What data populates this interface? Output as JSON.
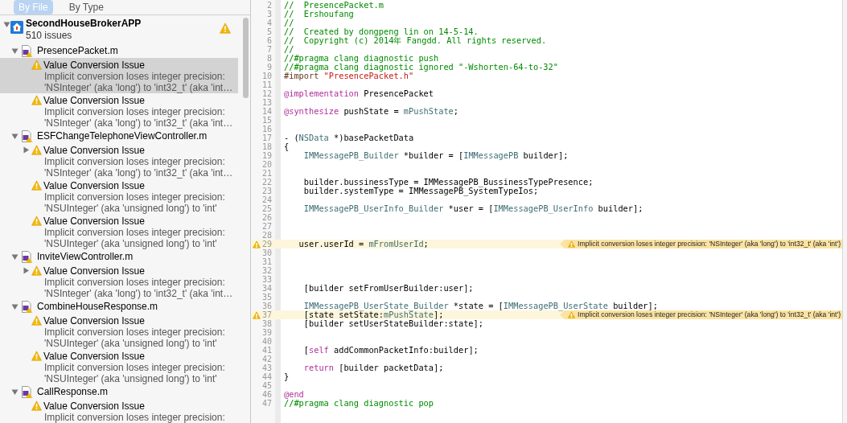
{
  "navigator": {
    "tabs": [
      {
        "label": "By File",
        "selected": true
      },
      {
        "label": "By Type",
        "selected": false
      }
    ],
    "project": {
      "name": "SecondHouseBrokerAPP",
      "count": "510 issues",
      "warning": true,
      "expanded": true
    },
    "files": [
      {
        "name": "PresencePacket.m",
        "expanded": true,
        "issues": [
          {
            "title": "Value Conversion Issue",
            "lines": [
              "Implicit conversion loses integer precision:",
              "'NSInteger' (aka 'long') to 'int32_t' (aka 'int…"
            ],
            "selected": true,
            "collapsed": false
          },
          {
            "title": "Value Conversion Issue",
            "lines": [
              "Implicit conversion loses integer precision:",
              "'NSInteger' (aka 'long') to 'int32_t' (aka 'int…"
            ],
            "selected": false,
            "collapsed": false
          }
        ]
      },
      {
        "name": "ESFChangeTelephoneViewController.m",
        "expanded": true,
        "issues": [
          {
            "title": "Value Conversion Issue",
            "lines": [
              "Implicit conversion loses integer precision:",
              "'NSInteger' (aka 'long') to 'int32_t' (aka 'int…"
            ],
            "selected": false,
            "collapsed": true
          },
          {
            "title": "Value Conversion Issue",
            "lines": [
              "Implicit conversion loses integer precision:",
              "'NSUInteger' (aka 'unsigned long') to 'int'"
            ],
            "selected": false,
            "collapsed": false
          },
          {
            "title": "Value Conversion Issue",
            "lines": [
              "Implicit conversion loses integer precision:",
              "'NSUInteger' (aka 'unsigned long') to 'int'"
            ],
            "selected": false,
            "collapsed": false
          }
        ]
      },
      {
        "name": "InviteViewController.m",
        "expanded": true,
        "issues": [
          {
            "title": "Value Conversion Issue",
            "lines": [
              "Implicit conversion loses integer precision:",
              "'NSInteger' (aka 'long') to 'int32_t' (aka 'int…"
            ],
            "selected": false,
            "collapsed": true
          }
        ]
      },
      {
        "name": "CombineHouseResponse.m",
        "expanded": true,
        "issues": [
          {
            "title": "Value Conversion Issue",
            "lines": [
              "Implicit conversion loses integer precision:",
              "'NSUInteger' (aka 'unsigned long') to 'int'"
            ],
            "selected": false,
            "collapsed": false
          },
          {
            "title": "Value Conversion Issue",
            "lines": [
              "Implicit conversion loses integer precision:",
              "'NSUInteger' (aka 'unsigned long') to 'int'"
            ],
            "selected": false,
            "collapsed": false
          }
        ]
      },
      {
        "name": "CallResponse.m",
        "expanded": true,
        "issues": [
          {
            "title": "Value Conversion Issue",
            "lines": [
              "Implicit conversion loses integer precision:"
            ],
            "selected": false,
            "collapsed": false
          }
        ]
      }
    ]
  },
  "editor": {
    "lines": [
      {
        "n": "2",
        "tokens": [
          {
            "kind": "comment",
            "t": "//  PresencePacket.m"
          }
        ]
      },
      {
        "n": "3",
        "tokens": [
          {
            "kind": "comment",
            "t": "//  Ershoufang"
          }
        ]
      },
      {
        "n": "4",
        "tokens": [
          {
            "kind": "comment",
            "t": "//"
          }
        ]
      },
      {
        "n": "5",
        "tokens": [
          {
            "kind": "comment",
            "t": "//  Created by dongpeng lin on 14-5-14."
          }
        ]
      },
      {
        "n": "6",
        "tokens": [
          {
            "kind": "comment",
            "t": "//  Copyright (c) 2014年 Fangdd. All rights reserved."
          }
        ]
      },
      {
        "n": "7",
        "tokens": [
          {
            "kind": "comment",
            "t": "//"
          }
        ]
      },
      {
        "n": "8",
        "tokens": [
          {
            "kind": "comment",
            "t": "//#pragma clang diagnostic push"
          }
        ]
      },
      {
        "n": "9",
        "tokens": [
          {
            "kind": "comment",
            "t": "//#pragma clang diagnostic ignored \"-Wshorten-64-to-32\""
          }
        ]
      },
      {
        "n": "10",
        "tokens": [
          {
            "kind": "preproc",
            "t": "#import "
          },
          {
            "kind": "string",
            "t": "\"PresencePacket.h\""
          }
        ]
      },
      {
        "n": "11"
      },
      {
        "n": "12",
        "tokens": [
          {
            "kind": "keyword",
            "t": "@implementation"
          },
          {
            "kind": "plain",
            "t": " PresencePacket"
          }
        ]
      },
      {
        "n": "13"
      },
      {
        "n": "14",
        "tokens": [
          {
            "kind": "keyword",
            "t": "@synthesize"
          },
          {
            "kind": "plain",
            "t": " pushState = "
          },
          {
            "kind": "type",
            "t": "mPushState"
          },
          {
            "kind": "plain",
            "t": ";"
          }
        ]
      },
      {
        "n": "15"
      },
      {
        "n": "16"
      },
      {
        "n": "17",
        "tokens": [
          {
            "kind": "plain",
            "t": "- ("
          },
          {
            "kind": "type",
            "t": "NSData"
          },
          {
            "kind": "plain",
            "t": " *)basePacketData"
          }
        ]
      },
      {
        "n": "18",
        "tokens": [
          {
            "kind": "plain",
            "t": "{"
          }
        ]
      },
      {
        "n": "19",
        "tokens": [
          {
            "kind": "type",
            "t": "    IMMessagePB_Builder"
          },
          {
            "kind": "plain",
            "t": " *builder = ["
          },
          {
            "kind": "type",
            "t": "IMMessagePB"
          },
          {
            "kind": "plain",
            "t": " builder];"
          }
        ]
      },
      {
        "n": "20"
      },
      {
        "n": "21"
      },
      {
        "n": "22",
        "tokens": [
          {
            "kind": "plain",
            "t": "    builder.bussinessType = IMMessagePB_BussinessTypePresence;"
          }
        ]
      },
      {
        "n": "23",
        "tokens": [
          {
            "kind": "plain",
            "t": "    builder.systemType = IMMessagePB_SystemTypeIos;"
          }
        ]
      },
      {
        "n": "24"
      },
      {
        "n": "25",
        "tokens": [
          {
            "kind": "type",
            "t": "    IMMessagePB_UserInfo_Builder"
          },
          {
            "kind": "plain",
            "t": " *user = ["
          },
          {
            "kind": "type",
            "t": "IMMessagePB_UserInfo"
          },
          {
            "kind": "plain",
            "t": " builder];"
          }
        ]
      },
      {
        "n": "26"
      },
      {
        "n": "27"
      },
      {
        "n": "28"
      },
      {
        "n": "29",
        "tokens": [
          {
            "kind": "plain",
            "t": "   user.userId = "
          },
          {
            "kind": "type",
            "t": "mFromUserId"
          },
          {
            "kind": "plain",
            "t": ";"
          }
        ],
        "warning": "Implicit conversion loses integer precision: 'NSInteger' (aka 'long') to 'int32_t' (aka 'int')"
      },
      {
        "n": "30"
      },
      {
        "n": "31"
      },
      {
        "n": "32"
      },
      {
        "n": "33"
      },
      {
        "n": "34",
        "tokens": [
          {
            "kind": "plain",
            "t": "    [builder setFromUserBuilder:user];"
          }
        ]
      },
      {
        "n": "35"
      },
      {
        "n": "36",
        "tokens": [
          {
            "kind": "type",
            "t": "    IMMessagePB_UserState_Builder"
          },
          {
            "kind": "plain",
            "t": " *state = ["
          },
          {
            "kind": "type",
            "t": "IMMessagePB_UserState"
          },
          {
            "kind": "plain",
            "t": " builder];"
          }
        ]
      },
      {
        "n": "37",
        "tokens": [
          {
            "kind": "plain",
            "t": "    [state setState:"
          },
          {
            "kind": "type",
            "t": "mPushState"
          },
          {
            "kind": "plain",
            "t": "];"
          }
        ],
        "warning": "Implicit conversion loses integer precision: 'NSInteger' (aka 'long') to 'int32_t' (aka 'int')"
      },
      {
        "n": "38",
        "tokens": [
          {
            "kind": "plain",
            "t": "    [builder setUserStateBuilder:state];"
          }
        ]
      },
      {
        "n": "39"
      },
      {
        "n": "40"
      },
      {
        "n": "41",
        "tokens": [
          {
            "kind": "plain",
            "t": "    ["
          },
          {
            "kind": "keyword",
            "t": "self"
          },
          {
            "kind": "plain",
            "t": " addCommonPacketInfo:builder];"
          }
        ]
      },
      {
        "n": "42"
      },
      {
        "n": "43",
        "tokens": [
          {
            "kind": "keyword",
            "t": "    return"
          },
          {
            "kind": "plain",
            "t": " [builder packetData];"
          }
        ]
      },
      {
        "n": "44",
        "tokens": [
          {
            "kind": "plain",
            "t": "}"
          }
        ]
      },
      {
        "n": "45"
      },
      {
        "n": "46",
        "tokens": [
          {
            "kind": "keyword",
            "t": "@end"
          }
        ]
      },
      {
        "n": "47",
        "tokens": [
          {
            "kind": "comment",
            "t": "//#pragma clang diagnostic pop"
          }
        ]
      }
    ]
  }
}
